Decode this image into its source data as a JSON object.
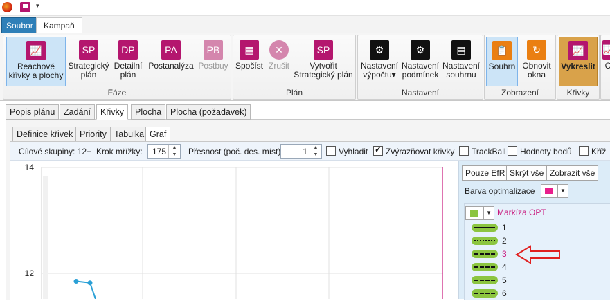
{
  "titlebar": {
    "qat_arrow": "▾"
  },
  "ribbon_tabs": [
    "Soubor",
    "Kampaň"
  ],
  "ribbon": {
    "groups": [
      {
        "label": "Fáze",
        "buttons": [
          {
            "line1": "Reachové",
            "line2": "křivky a plochy",
            "icon": "chart-icon",
            "glyph": "📈"
          },
          {
            "line1": "Strategický",
            "line2": "plán",
            "icon": "sp-icon",
            "glyph": "SP"
          },
          {
            "line1": "Detailní",
            "line2": "plán",
            "icon": "dp-icon",
            "glyph": "DP"
          },
          {
            "line1": "Postanalýza",
            "line2": "",
            "icon": "pa-icon",
            "glyph": "PA"
          },
          {
            "line1": "Postbuy",
            "line2": "",
            "icon": "pb-icon",
            "glyph": "PB"
          }
        ]
      },
      {
        "label": "Plán",
        "buttons": [
          {
            "line1": "Spočíst",
            "line2": "",
            "icon": "calculator-icon",
            "glyph": "▦"
          },
          {
            "line1": "Zrušit",
            "line2": "",
            "icon": "cancel-icon",
            "glyph": "✕"
          },
          {
            "line1": "Vytvořit",
            "line2": "Strategický plán",
            "icon": "sp-create-icon",
            "glyph": "SP"
          }
        ]
      },
      {
        "label": "Nastavení",
        "buttons": [
          {
            "line1": "Nastavení",
            "line2": "výpočtu▾",
            "icon": "gear-icon",
            "glyph": "⚙"
          },
          {
            "line1": "Nastavení",
            "line2": "podmínek",
            "icon": "gear-icon",
            "glyph": "⚙"
          },
          {
            "line1": "Nastavení",
            "line2": "souhrnu",
            "icon": "summary-icon",
            "glyph": "▤"
          }
        ]
      },
      {
        "label": "Zobrazení",
        "buttons": [
          {
            "line1": "Souhrn",
            "line2": "",
            "icon": "clipboard-icon",
            "glyph": "📋"
          },
          {
            "line1": "Obnovit",
            "line2": "okna",
            "icon": "refresh-icon",
            "glyph": "↻"
          }
        ]
      },
      {
        "label": "Křivky",
        "buttons": [
          {
            "line1": "Vykreslit",
            "line2": "",
            "icon": "draw-chart-icon",
            "glyph": "📈"
          }
        ]
      },
      {
        "label": "",
        "buttons": [
          {
            "line1": "C",
            "line2": "",
            "icon": "chart-icon",
            "glyph": "📈"
          }
        ]
      }
    ]
  },
  "plan_tabs": [
    "Popis plánu",
    "Zadání",
    "Křivky",
    "Plocha",
    "Plocha (požadavek)"
  ],
  "sub_tabs": [
    "Definice křivek",
    "Priority",
    "Tabulka",
    "Graf"
  ],
  "toolbar": {
    "target_groups": "Cílové skupiny: 12+",
    "grid_step_label": "Krok mřížky:",
    "grid_step_value": "175",
    "precision_label": "Přesnost (poč. des. míst):",
    "precision_value": "1",
    "smooth_label": "Vyhladit",
    "highlight_label": "Zvýrazňovat křivky",
    "trackball_label": "TrackBall",
    "values_label": "Hodnoty bodů",
    "kriz_label": "Kříž"
  },
  "right_panel": {
    "only_efr": "Pouze EfR",
    "hide_all": "Skrýt vše",
    "show_all": "Zobrazit vše",
    "opt_color_label": "Barva optimalizace",
    "opt_color": "#e91e8c",
    "station_color": "#8cc540",
    "station_name": "Markíza OPT",
    "curves": [
      "1",
      "2",
      "3",
      "4",
      "5",
      "6"
    ],
    "highlighted_curve_color": "#c8187d"
  },
  "colors": {
    "accent": "#b4166e",
    "file_tab": "#2e7fb8",
    "series": "#2aa0d6",
    "arrow": "#e02020"
  },
  "chart_data": {
    "type": "line",
    "ylim": [
      11.6,
      14
    ],
    "yticks": [
      "14",
      "12"
    ],
    "series": [
      {
        "values": [
          [
            0,
            11.85
          ],
          [
            1,
            11.82
          ]
        ]
      }
    ]
  }
}
